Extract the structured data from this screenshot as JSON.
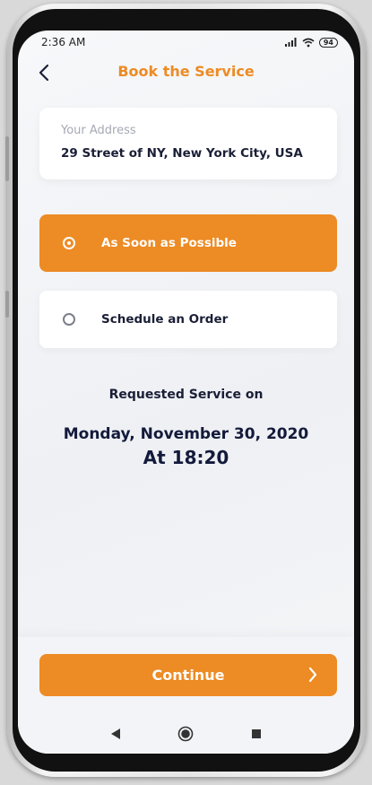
{
  "status_bar": {
    "time": "2:36 AM",
    "battery": "94"
  },
  "header": {
    "title": "Book the Service"
  },
  "address": {
    "label": "Your Address",
    "value": "29 Street of NY, New York City, USA"
  },
  "options": [
    {
      "label": "As Soon as Possible",
      "selected": true
    },
    {
      "label": "Schedule an Order",
      "selected": false
    }
  ],
  "requested": {
    "label": "Requested Service on",
    "date": "Monday, November 30, 2020",
    "time": "At 18:20"
  },
  "continue_button": {
    "label": "Continue"
  },
  "colors": {
    "accent": "#ed8b24",
    "text_dark": "#1a1f36",
    "muted": "#a6a9b4",
    "background": "#f3f4f7"
  },
  "icons": {
    "back": "chevron-left-icon",
    "continue": "chevron-right-icon",
    "nav_back": "triangle-back-icon",
    "nav_home": "circle-home-icon",
    "nav_recents": "square-recents-icon",
    "signal": "signal-icon",
    "wifi": "wifi-icon",
    "battery": "battery-icon"
  }
}
